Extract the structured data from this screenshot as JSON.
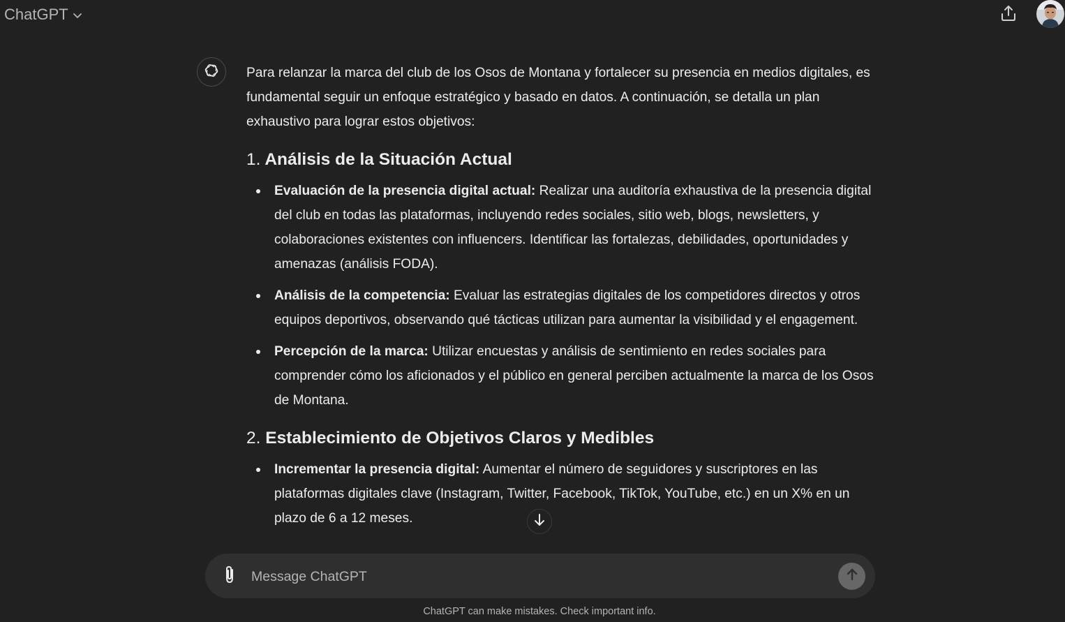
{
  "header": {
    "model_name": "ChatGPT",
    "model_dropdown_icon": "chevron-down-icon",
    "share_icon": "share-upload-icon",
    "avatar_icon": "user-avatar"
  },
  "message": {
    "assistant_icon": "openai-logo-icon",
    "intro": "Para relanzar la marca del club de los Osos de Montana y fortalecer su presencia en medios digitales, es fundamental seguir un enfoque estratégico y basado en datos. A continuación, se detalla un plan exhaustivo para lograr estos objetivos:",
    "sections": [
      {
        "number": "1.",
        "title": "Análisis de la Situación Actual",
        "items": [
          {
            "label": "Evaluación de la presencia digital actual:",
            "text": " Realizar una auditoría exhaustiva de la presencia digital del club en todas las plataformas, incluyendo redes sociales, sitio web, blogs, newsletters, y colaboraciones existentes con influencers. Identificar las fortalezas, debilidades, oportunidades y amenazas (análisis FODA)."
          },
          {
            "label": "Análisis de la competencia:",
            "text": " Evaluar las estrategias digitales de los competidores directos y otros equipos deportivos, observando qué tácticas utilizan para aumentar la visibilidad y el engagement."
          },
          {
            "label": "Percepción de la marca:",
            "text": " Utilizar encuestas y análisis de sentimiento en redes sociales para comprender cómo los aficionados y el público en general perciben actualmente la marca de los Osos de Montana."
          }
        ]
      },
      {
        "number": "2.",
        "title": "Establecimiento de Objetivos Claros y Medibles",
        "items": [
          {
            "label": "Incrementar la presencia digital:",
            "text": " Aumentar el número de seguidores y suscriptores en las plataformas digitales clave (Instagram, Twitter, Facebook, TikTok, YouTube, etc.) en un X% en un plazo de 6 a 12 meses."
          }
        ]
      }
    ]
  },
  "composer": {
    "placeholder": "Message ChatGPT",
    "attach_icon": "paperclip-icon",
    "send_icon": "arrow-up-icon"
  },
  "scroll_down_icon": "arrow-down-icon",
  "disclaimer": "ChatGPT can make mistakes. Check important info.",
  "colors": {
    "background": "#212121",
    "composer": "#2f2f2f",
    "text": "#ececec",
    "muted": "#b4b4b4",
    "send_button": "#676767"
  }
}
